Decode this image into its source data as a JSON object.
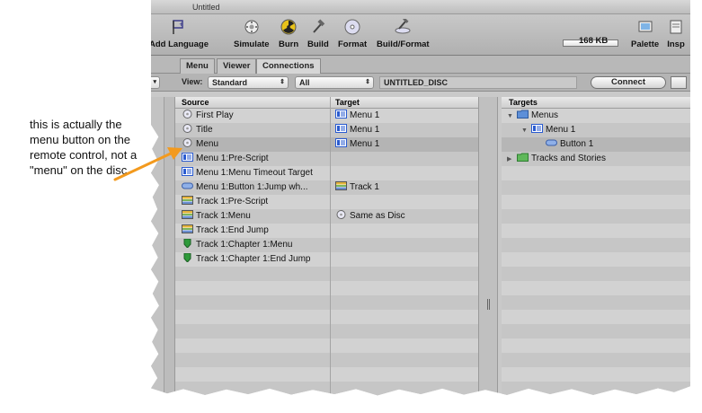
{
  "annotation": {
    "text": "this is actually the menu button on the remote control, not a \"menu\" on the disc"
  },
  "window": {
    "title": "Untitled"
  },
  "toolbar": {
    "items": [
      {
        "label": "Add Language",
        "icon": "flag-plus-icon"
      },
      {
        "label": "Simulate",
        "icon": "remote-control-icon"
      },
      {
        "label": "Burn",
        "icon": "burn-radioactive-icon"
      },
      {
        "label": "Build",
        "icon": "hammer-icon"
      },
      {
        "label": "Format",
        "icon": "disc-icon"
      },
      {
        "label": "Build/Format",
        "icon": "hammer-disc-icon"
      },
      {
        "label": "168 KB",
        "icon": "size-meter-icon"
      },
      {
        "label": "Palette",
        "icon": "palette-icon"
      },
      {
        "label": "Insp",
        "icon": "inspector-icon"
      }
    ]
  },
  "tabs": [
    {
      "label": "Menu"
    },
    {
      "label": "Viewer"
    },
    {
      "label": "Connections",
      "active": true
    }
  ],
  "viewbar": {
    "view_label": "View:",
    "view_value": "Standard",
    "filter_value": "All",
    "disc_name": "UNTITLED_DISC",
    "connect_label": "Connect"
  },
  "source_panel": {
    "header_source": "Source",
    "header_target": "Target",
    "rows": [
      {
        "source": "First Play",
        "source_icon": "disc-item-icon",
        "target": "Menu 1",
        "target_icon": "menu-icon"
      },
      {
        "source": "Title",
        "source_icon": "disc-item-icon",
        "target": "Menu 1",
        "target_icon": "menu-icon"
      },
      {
        "source": "Menu",
        "source_icon": "disc-item-icon",
        "target": "Menu 1",
        "target_icon": "menu-icon",
        "selected": true
      },
      {
        "source": "Menu 1:Pre-Script",
        "source_icon": "menu-icon",
        "target": "",
        "target_icon": ""
      },
      {
        "source": "Menu 1:Menu Timeout Target",
        "source_icon": "menu-icon",
        "target": "",
        "target_icon": ""
      },
      {
        "source": "Menu 1:Button 1:Jump wh...",
        "source_icon": "button-pill-icon",
        "target": "Track 1",
        "target_icon": "track-icon"
      },
      {
        "source": "Track 1:Pre-Script",
        "source_icon": "track-icon",
        "target": "",
        "target_icon": ""
      },
      {
        "source": "Track 1:Menu",
        "source_icon": "track-icon",
        "target": "Same as Disc",
        "target_icon": "disc-item-icon"
      },
      {
        "source": "Track 1:End Jump",
        "source_icon": "track-icon",
        "target": "",
        "target_icon": ""
      },
      {
        "source": "Track 1:Chapter 1:Menu",
        "source_icon": "chapter-marker-icon",
        "target": "",
        "target_icon": ""
      },
      {
        "source": "Track 1:Chapter 1:End Jump",
        "source_icon": "chapter-marker-icon",
        "target": "",
        "target_icon": ""
      }
    ]
  },
  "targets_panel": {
    "header": "Targets",
    "rows": [
      {
        "label": "Menus",
        "icon": "folder-blue-icon",
        "level": 0,
        "disclosure": "open"
      },
      {
        "label": "Menu 1",
        "icon": "menu-icon",
        "level": 1,
        "disclosure": "open"
      },
      {
        "label": "Button 1",
        "icon": "button-pill-icon",
        "level": 2,
        "disclosure": "",
        "selected": true
      },
      {
        "label": "Tracks and Stories",
        "icon": "folder-green-icon",
        "level": 0,
        "disclosure": "closed"
      }
    ]
  },
  "colors": {
    "annotation_arrow": "#f39a1e",
    "menu_icon": "#2a5bd0",
    "track_icon": "#e3b33a",
    "chapter_icon": "#2e9a3a",
    "folder_blue": "#5d8fd8",
    "folder_green": "#5fb85a"
  }
}
